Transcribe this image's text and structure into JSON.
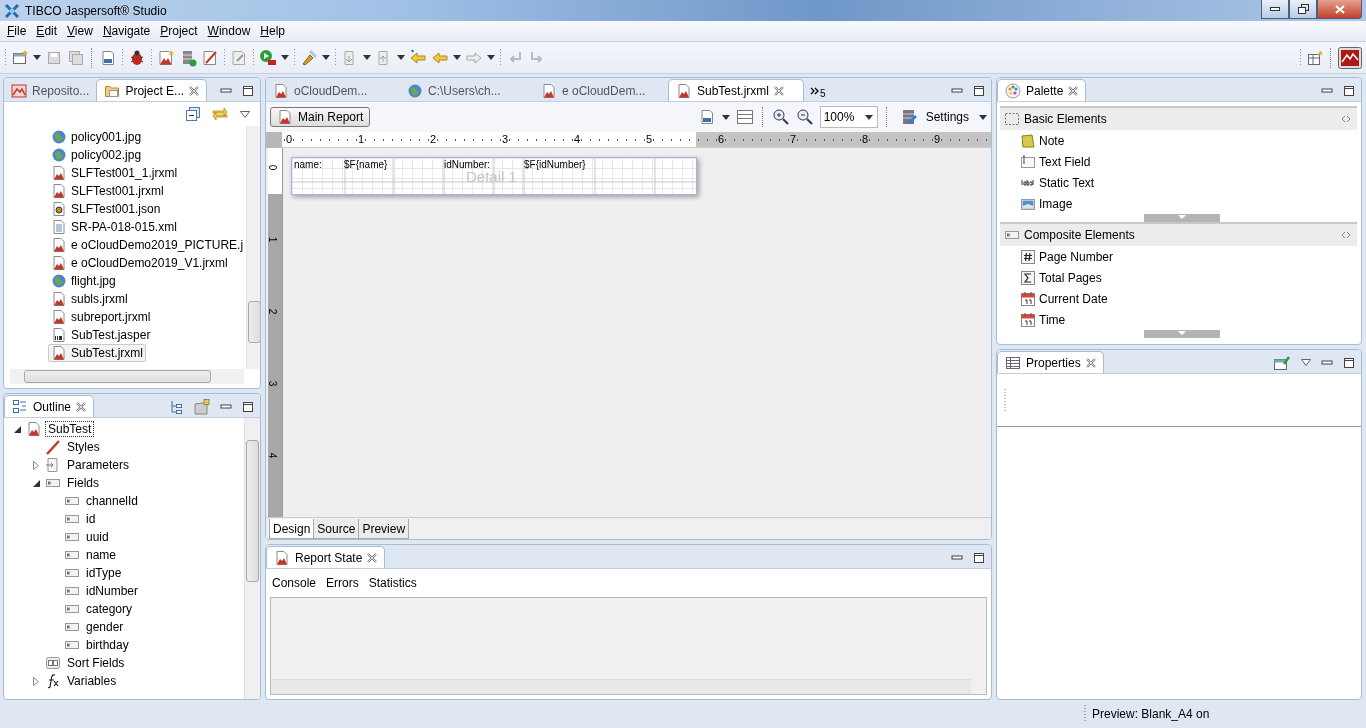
{
  "window": {
    "title": "TIBCO Jaspersoft® Studio"
  },
  "menu": [
    "File",
    "Edit",
    "View",
    "Navigate",
    "Project",
    "Window",
    "Help"
  ],
  "project_explorer": {
    "tabs": [
      {
        "label": "Reposito...",
        "kind": "repository",
        "selected": false
      },
      {
        "label": "Project E...",
        "kind": "folder",
        "selected": true
      }
    ],
    "items": [
      {
        "label": "policy001.jpg",
        "kind": "image",
        "selected": false
      },
      {
        "label": "policy002.jpg",
        "kind": "image",
        "selected": false
      },
      {
        "label": "SLFTest001_1.jrxml",
        "kind": "report",
        "selected": false
      },
      {
        "label": "SLFTest001.jrxml",
        "kind": "report",
        "selected": false
      },
      {
        "label": "SLFTest001.json",
        "kind": "json",
        "selected": false
      },
      {
        "label": "SR-PA-018-015.xml",
        "kind": "xml",
        "selected": false
      },
      {
        "label": "e    oCloudDemo2019_PICTURE.j",
        "kind": "report",
        "selected": false
      },
      {
        "label": "e     oCloudDemo2019_V1.jrxml",
        "kind": "report",
        "selected": false
      },
      {
        "label": "flight.jpg",
        "kind": "image",
        "selected": false
      },
      {
        "label": "subls.jrxml",
        "kind": "report",
        "selected": false
      },
      {
        "label": "subreport.jrxml",
        "kind": "report",
        "selected": false
      },
      {
        "label": "SubTest.jasper",
        "kind": "jasper",
        "selected": false
      },
      {
        "label": "SubTest.jrxml",
        "kind": "report",
        "selected": true
      }
    ]
  },
  "editor": {
    "tabs": [
      {
        "label": "oCloudDem...",
        "kind": "report",
        "selected": false
      },
      {
        "label": "C:\\Users\\ch...",
        "kind": "image",
        "selected": false
      },
      {
        "label": "e      oCloudDem...",
        "kind": "report",
        "selected": false
      },
      {
        "label": "SubTest.jrxml",
        "kind": "report",
        "selected": true
      }
    ],
    "overflow_count": "5",
    "main_report": "Main Report",
    "zoom": "100%",
    "settings": "Settings",
    "ruler": [
      "0",
      "1",
      "2",
      "3",
      "4",
      "5",
      "6",
      "7",
      "8",
      "9"
    ],
    "side_ruler": [
      "0",
      "1",
      "2",
      "3",
      "4"
    ],
    "band": {
      "label": "Detail 1",
      "fields": [
        {
          "text": "name:"
        },
        {
          "text": "$F{name}"
        },
        {
          "text": "idNumber:"
        },
        {
          "text": "$F{idNumber}"
        }
      ]
    },
    "views": [
      {
        "label": "Design",
        "selected": true
      },
      {
        "label": "Source",
        "selected": false
      },
      {
        "label": "Preview",
        "selected": false
      }
    ]
  },
  "outline": {
    "title": "Outline",
    "tree": [
      {
        "label": "SubTest",
        "kind": "report",
        "selected": true,
        "expanded": true,
        "children": [
          {
            "label": "Styles",
            "kind": "styles",
            "selected": false
          },
          {
            "label": "Parameters",
            "kind": "parameters",
            "selected": false,
            "expanded": false
          },
          {
            "label": "Fields",
            "kind": "fields",
            "selected": false,
            "expanded": true,
            "children": [
              {
                "label": "channelId",
                "kind": "field",
                "selected": false
              },
              {
                "label": "id",
                "kind": "field",
                "selected": false
              },
              {
                "label": "uuid",
                "kind": "field",
                "selected": false
              },
              {
                "label": "name",
                "kind": "field",
                "selected": false
              },
              {
                "label": "idType",
                "kind": "field",
                "selected": false
              },
              {
                "label": "idNumber",
                "kind": "field",
                "selected": false
              },
              {
                "label": "category",
                "kind": "field",
                "selected": false
              },
              {
                "label": "gender",
                "kind": "field",
                "selected": false
              },
              {
                "label": "birthday",
                "kind": "field",
                "selected": false
              }
            ]
          },
          {
            "label": "Sort Fields",
            "kind": "sort",
            "selected": false
          },
          {
            "label": "Variables",
            "kind": "variables",
            "selected": false,
            "expanded": false
          }
        ]
      }
    ]
  },
  "report_state": {
    "title": "Report State",
    "tabs": [
      "Console",
      "Errors",
      "Statistics"
    ]
  },
  "palette": {
    "title": "Palette",
    "groups": [
      {
        "title": "Basic Elements",
        "kind": "basic",
        "items": [
          {
            "label": "Note",
            "kind": "note"
          },
          {
            "label": "Text Field",
            "kind": "text-field"
          },
          {
            "label": "Static Text",
            "kind": "static-text"
          },
          {
            "label": "Image",
            "kind": "picture-element"
          }
        ]
      },
      {
        "title": "Composite Elements",
        "kind": "field",
        "items": [
          {
            "label": "Page Number",
            "kind": "page-number"
          },
          {
            "label": "Total Pages",
            "kind": "total-pages"
          },
          {
            "label": "Current Date",
            "kind": "date"
          },
          {
            "label": "Time",
            "kind": "date"
          }
        ]
      }
    ]
  },
  "properties": {
    "title": "Properties"
  },
  "status_bar": {
    "text": "Preview: Blank_A4 on"
  }
}
